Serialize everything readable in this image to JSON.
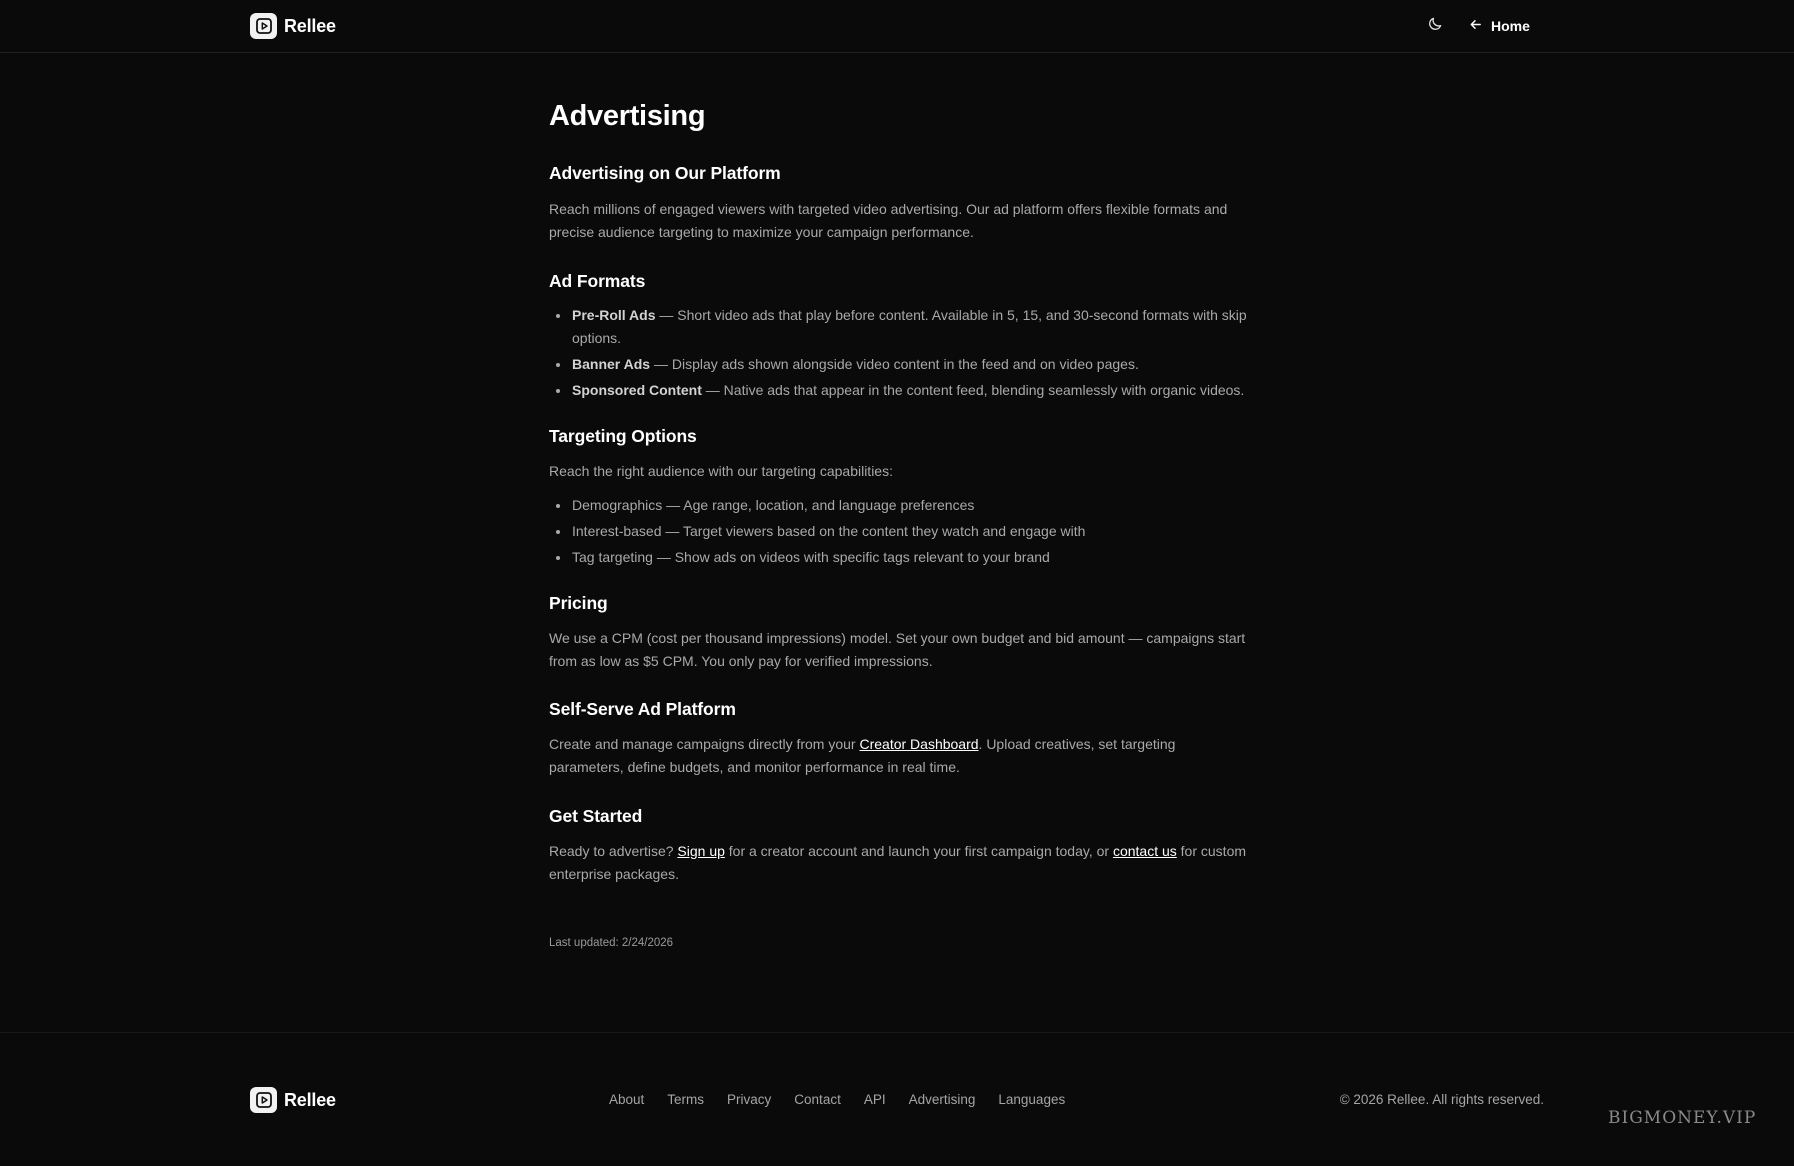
{
  "header": {
    "brand": "Rellee",
    "home_label": "Home",
    "icons": {
      "logo": "play-square-icon",
      "theme": "moon-icon",
      "back": "arrow-left-icon"
    }
  },
  "main": {
    "title": "Advertising",
    "sections": {
      "platform": {
        "heading": "Advertising on Our Platform",
        "text": "Reach millions of engaged viewers with targeted video advertising. Our ad platform offers flexible formats and precise audience targeting to maximize your campaign performance."
      },
      "formats": {
        "heading": "Ad Formats",
        "items": [
          {
            "name": "Pre-Roll Ads",
            "desc": " — Short video ads that play before content. Available in 5, 15, and 30-second formats with skip options."
          },
          {
            "name": "Banner Ads",
            "desc": " — Display ads shown alongside video content in the feed and on video pages."
          },
          {
            "name": "Sponsored Content",
            "desc": " — Native ads that appear in the content feed, blending seamlessly with organic videos."
          }
        ]
      },
      "targeting": {
        "heading": "Targeting Options",
        "intro": "Reach the right audience with our targeting capabilities:",
        "items": [
          "Demographics — Age range, location, and language preferences",
          "Interest-based — Target viewers based on the content they watch and engage with",
          "Tag targeting — Show ads on videos with specific tags relevant to your brand"
        ]
      },
      "pricing": {
        "heading": "Pricing",
        "text": "We use a CPM (cost per thousand impressions) model. Set your own budget and bid amount — campaigns start from as low as $5 CPM. You only pay for verified impressions."
      },
      "selfserve": {
        "heading": "Self-Serve Ad Platform",
        "before": "Create and manage campaigns directly from your ",
        "link": "Creator Dashboard",
        "after": ". Upload creatives, set targeting parameters, define budgets, and monitor performance in real time."
      },
      "getstarted": {
        "heading": "Get Started",
        "before": "Ready to advertise? ",
        "signup_link": "Sign up",
        "middle": " for a creator account and launch your first campaign today, or ",
        "contact_link": "contact us",
        "after": " for custom enterprise packages."
      }
    },
    "last_updated": "Last updated: 2/24/2026"
  },
  "footer": {
    "brand": "Rellee",
    "links": [
      "About",
      "Terms",
      "Privacy",
      "Contact",
      "API",
      "Advertising",
      "Languages"
    ],
    "copyright": "© 2026 Rellee. All rights reserved."
  },
  "watermark": "BIGMONEY.VIP"
}
